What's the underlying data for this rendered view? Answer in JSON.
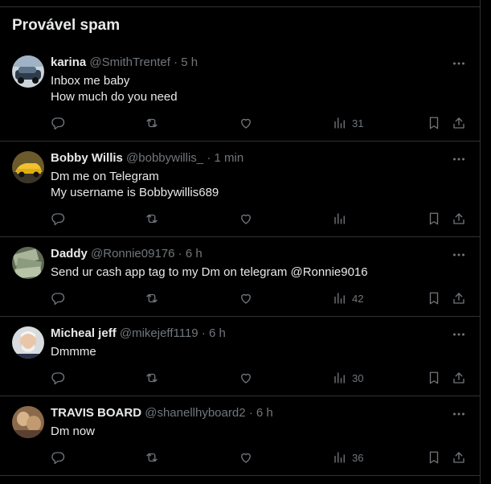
{
  "section_title": "Provável spam",
  "tweets": [
    {
      "name": "karina",
      "handle": "@SmithTrentef",
      "time": "5 h",
      "lines": [
        "Inbox me baby",
        "How much do you need"
      ],
      "views": "31"
    },
    {
      "name": "Bobby Willis",
      "handle": "@bobbywillis_",
      "time": "1 min",
      "lines": [
        "Dm me on Telegram",
        "My username is Bobbywillis689"
      ],
      "views": ""
    },
    {
      "name": "Daddy",
      "handle": "@Ronnie09176",
      "time": "6 h",
      "lines": [
        "Send ur cash app tag to my Dm on telegram @Ronnie9016"
      ],
      "views": "42"
    },
    {
      "name": "Micheal jeff",
      "handle": "@mikejeff1119",
      "time": "6 h",
      "lines": [
        "Dmmme"
      ],
      "views": "30"
    },
    {
      "name": "TRAVIS BOARD",
      "handle": "@shanellhyboard2",
      "time": "6 h",
      "lines": [
        "Dm now"
      ],
      "views": "36"
    }
  ],
  "separator": "·",
  "icons": {
    "reply": "reply-icon",
    "repost": "repost-icon",
    "like": "like-icon",
    "views": "views-icon",
    "bookmark": "bookmark-icon",
    "share": "share-icon",
    "more": "more-icon"
  },
  "colors": {
    "background": "#000000",
    "text": "#e7e9ea",
    "muted": "#71767b",
    "border": "#2f3336"
  }
}
